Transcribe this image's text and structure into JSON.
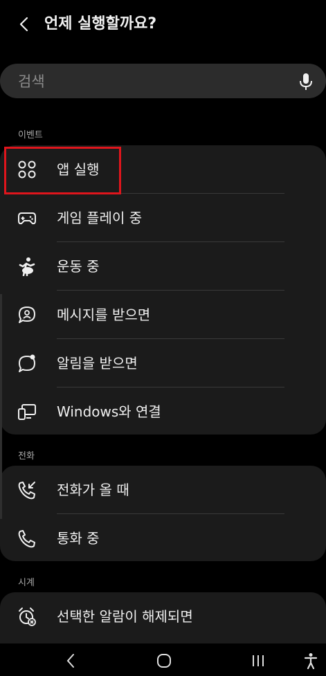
{
  "header": {
    "back_icon": "chevron-left-icon",
    "title": "언제 실행할까요?"
  },
  "search": {
    "placeholder": "검색",
    "mic_icon": "microphone-icon"
  },
  "sections": {
    "events": {
      "label": "이벤트",
      "items": [
        {
          "label": "앱 실행",
          "icon": "apps-grid-icon",
          "highlighted": true
        },
        {
          "label": "게임 플레이 중",
          "icon": "gamepad-icon"
        },
        {
          "label": "운동 중",
          "icon": "running-person-icon"
        },
        {
          "label": "메시지를 받으면",
          "icon": "message-person-icon"
        },
        {
          "label": "알림을 받으면",
          "icon": "notification-bubble-icon"
        },
        {
          "label": "Windows와 연결",
          "icon": "link-to-windows-icon"
        }
      ]
    },
    "call": {
      "label": "전화",
      "items": [
        {
          "label": "전화가 올 때",
          "icon": "incoming-call-icon"
        },
        {
          "label": "통화 중",
          "icon": "phone-icon"
        }
      ]
    },
    "clock": {
      "label": "시계",
      "items": [
        {
          "label": "선택한 알람이 해제되면",
          "icon": "alarm-off-icon"
        }
      ]
    }
  },
  "navbar": {
    "back_icon": "nav-back-icon",
    "home_icon": "nav-home-icon",
    "recents_icon": "nav-recents-icon",
    "accessibility_icon": "accessibility-icon"
  },
  "colors": {
    "background": "#000000",
    "card": "#1b1b1b",
    "search": "#2c2c2c",
    "highlight": "#e0151c"
  }
}
